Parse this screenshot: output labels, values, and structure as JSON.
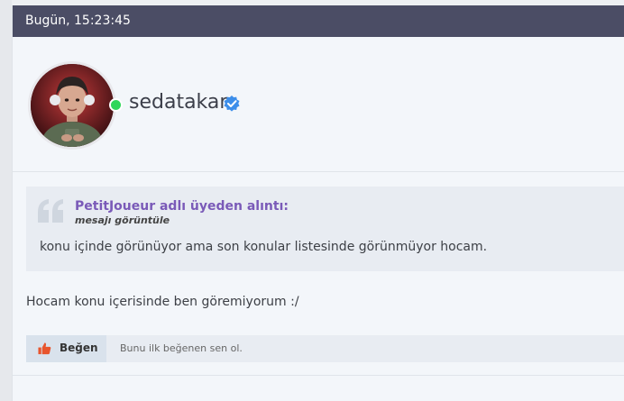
{
  "post": {
    "timestamp": "Bugün, 15:23:45",
    "body": "Hocam konu içerisinde ben göremiyorum :/"
  },
  "user": {
    "username": "sedatakar",
    "status": "online",
    "verified": true
  },
  "quote": {
    "author_line": "PetitJoueur adlı üyeden alıntı:",
    "view_link": "mesajı görüntüle",
    "text": "konu içinde görünüyor ama son konular listesinde görünmüyor hocam."
  },
  "reactions": {
    "like_label": "Beğen",
    "like_info": "Bunu ilk beğenen sen ol."
  },
  "colors": {
    "header_bg": "#4b4d65",
    "accent": "#7a5ab8",
    "online": "#2fd65a",
    "verified": "#3d8eea",
    "like": "#e8552d"
  }
}
